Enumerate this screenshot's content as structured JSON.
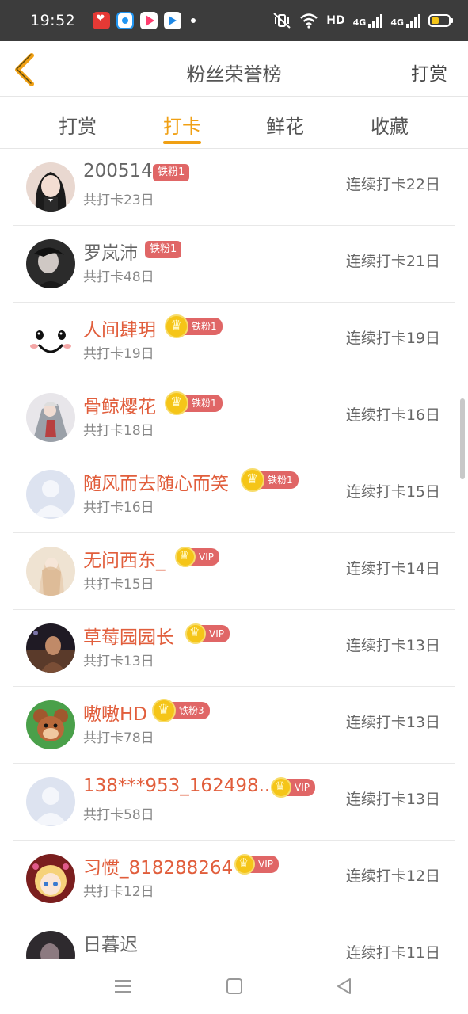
{
  "status_bar": {
    "time": "19:52",
    "hd_label": "HD",
    "net_label_1": "4G",
    "net_label_2": "4G",
    "app_icons": [
      "heart-app-icon",
      "circle-app-icon",
      "video-play-app-icon",
      "tv-app-icon"
    ],
    "battery_level": 0.3
  },
  "header": {
    "title": "粉丝荣誉榜",
    "action": "打赏"
  },
  "tabs": [
    {
      "label": "打赏",
      "active": false
    },
    {
      "label": "打卡",
      "active": true
    },
    {
      "label": "鲜花",
      "active": false
    },
    {
      "label": "收藏",
      "active": false
    }
  ],
  "colors": {
    "accent": "#f0a014",
    "highlight_name": "#e15e3c",
    "badge_red": "#e06666",
    "crown_gold": "#f5c518"
  },
  "fans": [
    {
      "name": "200514",
      "badge_type": "tag",
      "badge": "铁粉1",
      "total": "共打卡23日",
      "streak": "连续打卡22日",
      "highlight": false,
      "avatar": "girl-photo"
    },
    {
      "name": "罗岚沛",
      "badge_type": "tag",
      "badge": "铁粉1",
      "total": "共打卡48日",
      "streak": "连续打卡21日",
      "highlight": false,
      "avatar": "dark-photo"
    },
    {
      "name": "人间肆玥",
      "badge_type": "crown",
      "badge": "铁粉1",
      "total": "共打卡19日",
      "streak": "连续打卡19日",
      "highlight": true,
      "avatar": "smiley-face"
    },
    {
      "name": "骨鲸樱花",
      "badge_type": "crown",
      "badge": "铁粉1",
      "total": "共打卡18日",
      "streak": "连续打卡16日",
      "highlight": true,
      "avatar": "anime-photo"
    },
    {
      "name": "随风而去随心而笑",
      "badge_type": "crown",
      "badge": "铁粉1",
      "total": "共打卡16日",
      "streak": "连续打卡15日",
      "highlight": true,
      "avatar": "default-avatar"
    },
    {
      "name": "无问西东_",
      "badge_type": "vip",
      "badge": "VIP",
      "total": "共打卡15日",
      "streak": "连续打卡14日",
      "highlight": true,
      "avatar": "painting-photo"
    },
    {
      "name": "草莓园园长",
      "badge_type": "vip",
      "badge": "VIP",
      "total": "共打卡13日",
      "streak": "连续打卡13日",
      "highlight": true,
      "avatar": "night-photo"
    },
    {
      "name": "嗷嗷HD",
      "badge_type": "crown",
      "badge": "铁粉3",
      "total": "共打卡78日",
      "streak": "连续打卡13日",
      "highlight": true,
      "avatar": "cartoon-mouse"
    },
    {
      "name": "138***953_162498...",
      "badge_type": "vip",
      "badge": "VIP",
      "total": "共打卡58日",
      "streak": "连续打卡13日",
      "highlight": true,
      "avatar": "default-avatar"
    },
    {
      "name": "习惯_818288264",
      "badge_type": "vip",
      "badge": "VIP",
      "total": "共打卡12日",
      "streak": "连续打卡12日",
      "highlight": true,
      "avatar": "anime-girl"
    },
    {
      "name": "日暮迟",
      "badge_type": "none",
      "badge": "",
      "total": "",
      "streak": "连续打卡11日",
      "highlight": false,
      "avatar": "dark-photo-2"
    }
  ]
}
